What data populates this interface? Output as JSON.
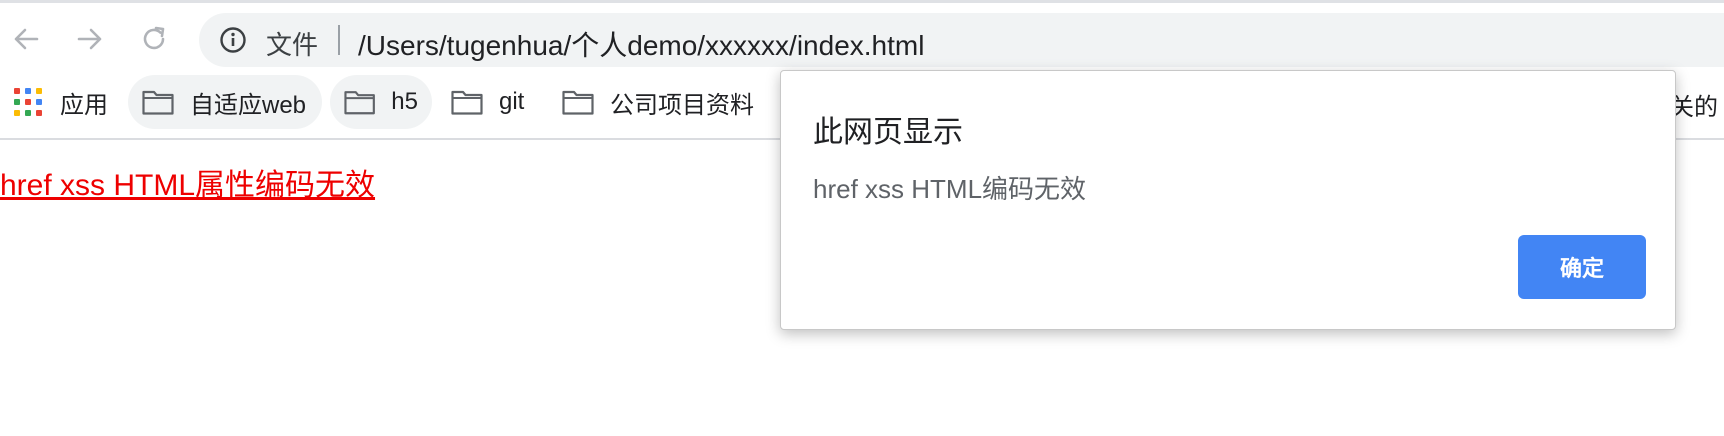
{
  "toolbar": {
    "back_icon": "arrow-left-icon",
    "forward_icon": "arrow-right-icon",
    "reload_icon": "reload-icon",
    "info_icon": "info-icon",
    "file_label": "文件",
    "url": "/Users/tugenhua/个人demo/xxxxxx/index.html"
  },
  "bookmarks": {
    "items": [
      {
        "label": "应用",
        "icon": "apps-grid-icon"
      },
      {
        "label": "自适应web",
        "icon": "folder-icon"
      },
      {
        "label": "h5",
        "icon": "folder-icon"
      },
      {
        "label": "git",
        "icon": "folder-icon"
      },
      {
        "label": "公司项目资料",
        "icon": "folder-icon"
      }
    ],
    "cut_off_text": "关的"
  },
  "page": {
    "link_text": "href xss HTML属性编码无效",
    "link_color": "#ee0000"
  },
  "dialog": {
    "title": "此网页显示",
    "message": "href xss HTML编码无效",
    "ok_label": "确定",
    "accent": "#4285f4"
  }
}
